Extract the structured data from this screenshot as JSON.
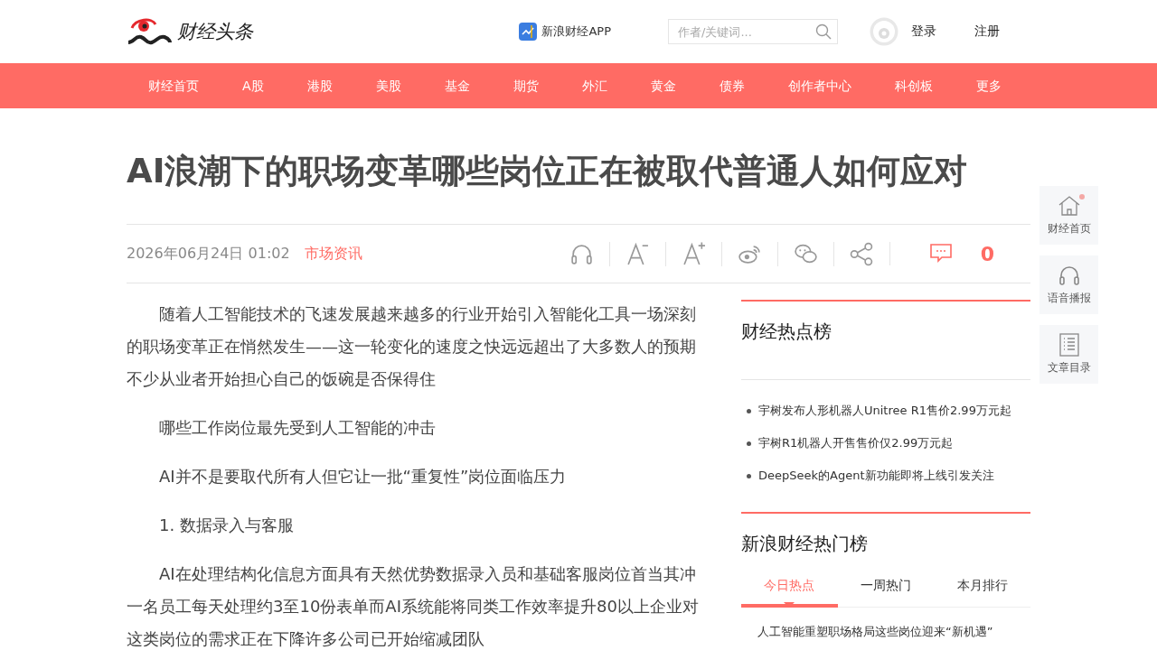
{
  "header": {
    "logo_text": "财经头条",
    "app_link": "新浪财经APP",
    "search": {
      "placeholder": "作者/关键词..."
    },
    "login": "登录",
    "register": "注册"
  },
  "nav": [
    "财经首页",
    "A股",
    "港股",
    "美股",
    "基金",
    "期货",
    "外汇",
    "黄金",
    "债券",
    "创作者中心",
    "科创板",
    "更多"
  ],
  "article": {
    "title": "AI浪潮下的职场变革哪些岗位正在被取代普通人如何应对",
    "date": "2026年06月24日 01:02",
    "source": "市场资讯",
    "comment_count": "0",
    "paragraphs": [
      "随着人工智能技术的飞速发展越来越多的行业开始引入智能化工具一场深刻的职场变革正在悄然发生——这一轮变化的速度之快远远超出了大多数人的预期不少从业者开始担心自己的饭碗是否保得住",
      "哪些工作岗位最先受到人工智能的冲击",
      "AI并不是要取代所有人但它让一批“重复性”岗位面临压力",
      "1. 数据录入与客服",
      "AI在处理结构化信息方面具有天然优势数据录入员和基础客服岗位首当其冲一名员工每天处理约3至10份表单而AI系统能将同类工作效率提升80以上企业对这类岗位的需求正在下降许多公司已开始缩减团队"
    ]
  },
  "related": {
    "title": "财经热点榜",
    "items": [
      "宇树发布人形机器人Unitree R1售价2.99万元起",
      "宇树R1机器人开售售价仅2.99万元起",
      "DeepSeek的Agent新功能即将上线引发关注"
    ]
  },
  "ranking": {
    "title": "新浪财经热门榜",
    "tabs": [
      {
        "label": "今日热点",
        "selected": true
      },
      {
        "label": "一周热门",
        "selected": false
      },
      {
        "label": "本月排行",
        "selected": false
      }
    ],
    "items": [
      "人工智能重塑职场格局这些岗位迎来“新机遇”"
    ]
  },
  "float_tools": [
    {
      "kind": "home",
      "label": "财经首页",
      "dot": true
    },
    {
      "kind": "listen",
      "label": "语音播报",
      "dot": false
    },
    {
      "kind": "toc",
      "label": "文章目录",
      "dot": false
    }
  ]
}
